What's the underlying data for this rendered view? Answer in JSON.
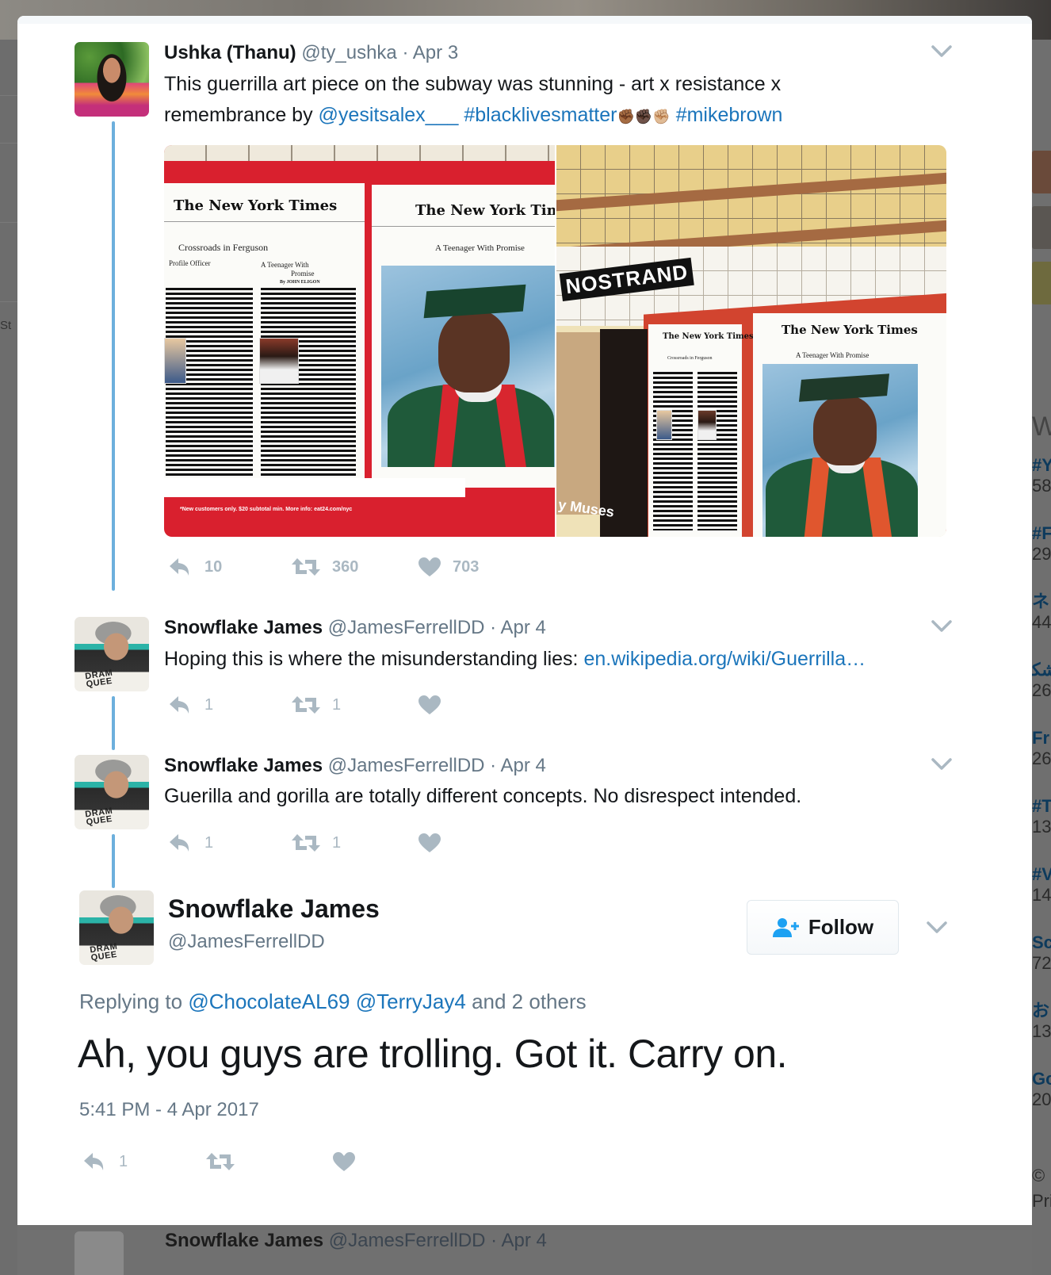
{
  "thread": [
    {
      "author_name": "Ushka (Thanu)",
      "handle": "@ty_ushka",
      "separator": "·",
      "date": "Apr 3",
      "text_line1": "This guerrilla art piece on the subway was stunning - art x resistance x",
      "text_line2_prefix": "remembrance by ",
      "mention": "@yesitsalex___",
      "hashtag1": "#blacklivesmatter",
      "emoji": "✊🏾✊🏿✊🏼",
      "hashtag2": "#mikebrown",
      "media": {
        "photo1": {
          "masthead": "The New York Times",
          "left_headline": "Crossroads in Ferguson",
          "left_sub": "Profile Officer",
          "mid_sub1": "A Teenager With",
          "mid_sub2": "Promise",
          "byline": "By JOHN ELIGON",
          "right_headline": "A Teenager With Promise",
          "ad_text": "*New customers only. $20 subtotal min. More info: eat24.com/nyc"
        },
        "photo2": {
          "station_sign": "NOSTRAND",
          "masthead": "The New York Times",
          "right_headline": "A Teenager With Promise",
          "left_headline": "Crossroads in Ferguson",
          "poster_text": "y Muses"
        }
      },
      "actions": {
        "replies": "10",
        "retweets": "360",
        "likes": "703"
      }
    },
    {
      "author_name": "Snowflake James",
      "handle": "@JamesFerrellDD",
      "separator": "·",
      "date": "Apr 4",
      "text_prefix": "Hoping this is where the misunderstanding lies: ",
      "link": "en.wikipedia.org/wiki/Guerrilla…",
      "avatar_mug_text": "DRAM\nQUEE",
      "actions": {
        "replies": "1",
        "retweets": "1",
        "likes": ""
      }
    },
    {
      "author_name": "Snowflake James",
      "handle": "@JamesFerrellDD",
      "separator": "·",
      "date": "Apr 4",
      "text": "Guerilla and gorilla are totally different concepts. No disrespect intended.",
      "actions": {
        "replies": "1",
        "retweets": "1",
        "likes": ""
      }
    }
  ],
  "main_tweet": {
    "author_name": "Snowflake James",
    "handle": "@JamesFerrellDD",
    "follow_label": "Follow",
    "replying_prefix": "Replying to ",
    "replying_mention1": "@ChocolateAL69",
    "replying_mention2": "@TerryJay4",
    "replying_suffix": " and 2 others",
    "text": "Ah, you guys are trolling. Got it. Carry on.",
    "timestamp": "5:41 PM - 4 Apr 2017",
    "actions": {
      "replies": "1",
      "retweets": "",
      "likes": ""
    }
  },
  "background": {
    "left_fragment": "St",
    "trends": [
      {
        "name": "W",
        "count": ""
      },
      {
        "name": "#Y",
        "count": "58"
      },
      {
        "name": "#F",
        "count": "29"
      },
      {
        "name": "ネ",
        "count": "44"
      },
      {
        "name": "ﺷﻜ",
        "count": "26"
      },
      {
        "name": "Fr",
        "count": "26"
      },
      {
        "name": "#T",
        "count": "13"
      },
      {
        "name": "#V",
        "count": "14"
      },
      {
        "name": "Sc",
        "count": "72"
      },
      {
        "name": "お",
        "count": "13"
      },
      {
        "name": "Gc",
        "count": "20"
      }
    ],
    "footer_fragment1": "©",
    "footer_fragment2": "Pri",
    "next_tweet_name": "Snowflake James",
    "next_tweet_meta": "@JamesFerrellDD · Apr 4"
  },
  "colors": {
    "link": "#1b75bb",
    "thread_line": "#6cafdc",
    "action_gray": "#aab8c2",
    "meta_gray": "#657786",
    "follow_icon": "#1da1f2"
  }
}
